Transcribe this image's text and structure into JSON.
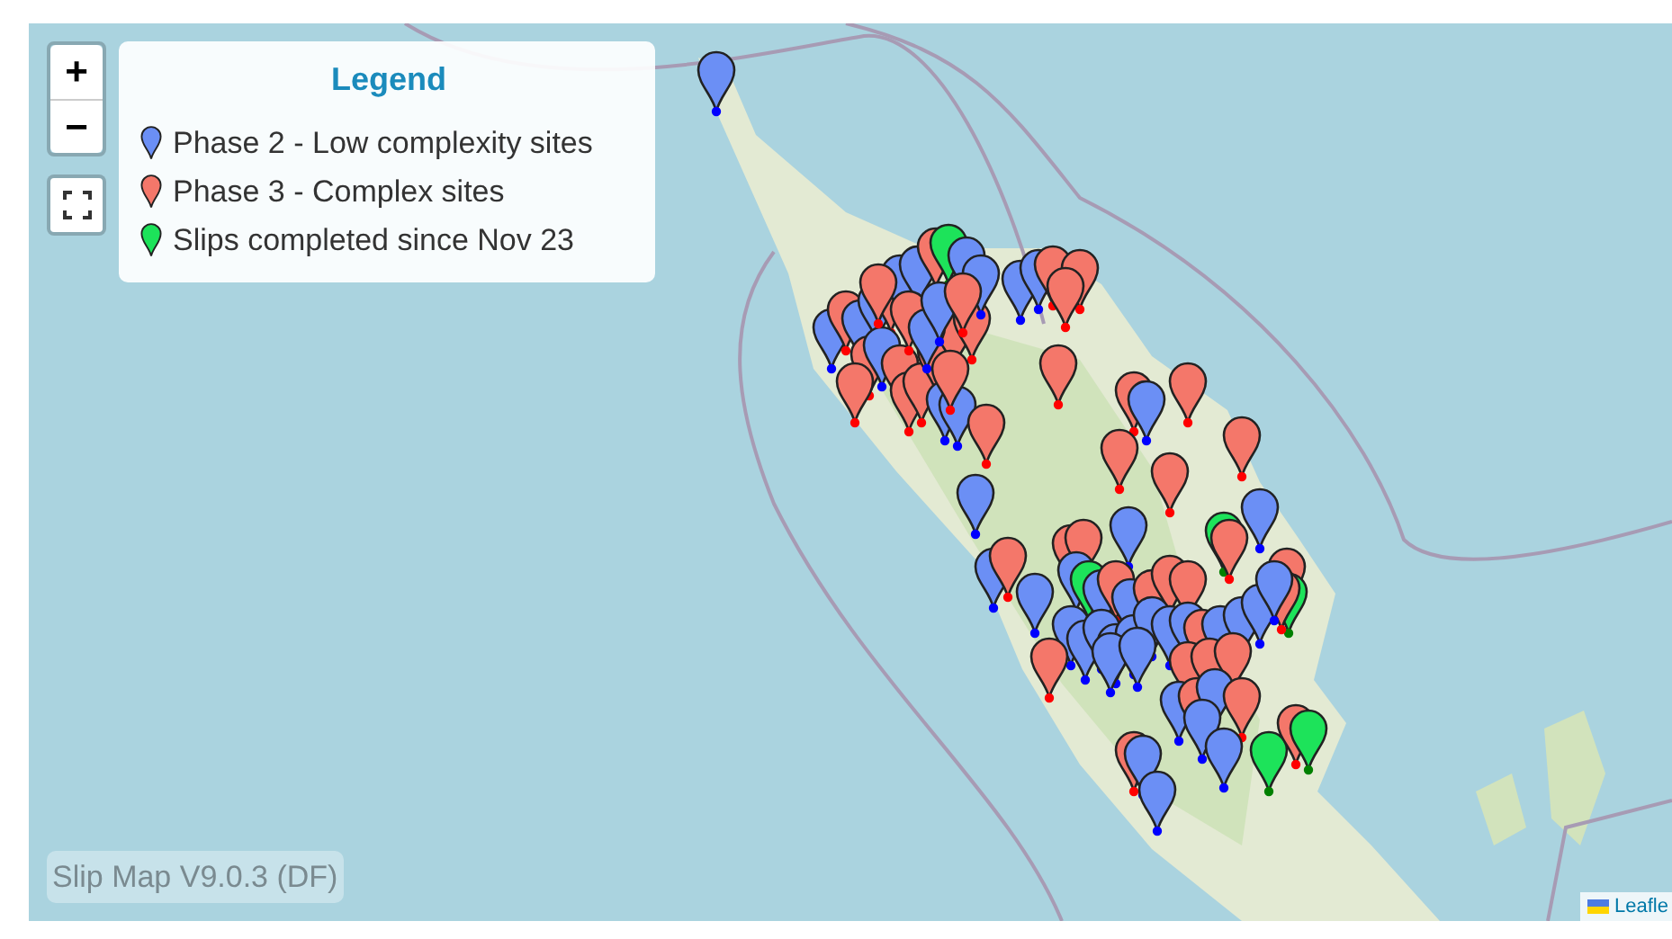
{
  "map_controls": {
    "zoom_in": "+",
    "zoom_out": "−"
  },
  "legend": {
    "title": "Legend",
    "items": [
      {
        "label": "Phase 2 - Low complexity sites",
        "color": "#6b8ff5"
      },
      {
        "label": "Phase 3 - Complex sites",
        "color": "#f4776a"
      },
      {
        "label": "Slips completed since Nov 23",
        "color": "#1de35a"
      }
    ]
  },
  "version_label": "Slip Map V9.0.3 (DF)",
  "attribution": "Leafle"
}
